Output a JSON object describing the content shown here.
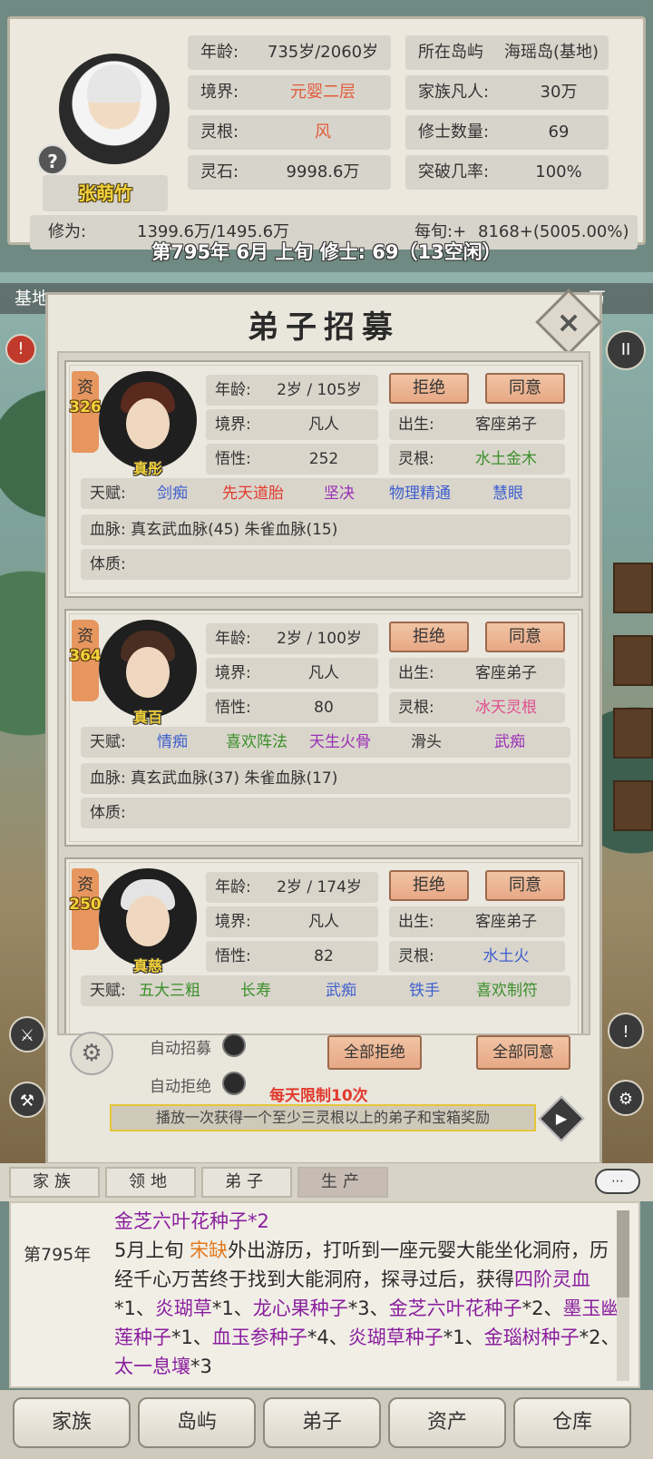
{
  "player": {
    "name": "张萌竹",
    "age_label": "年龄:",
    "age_value": "735岁/2060岁",
    "realm_label": "境界:",
    "realm_value": "元婴二层",
    "root_label": "灵根:",
    "root_value": "风",
    "stones_label": "灵石:",
    "stones_value": "9998.6万",
    "island_label": "所在岛屿",
    "island_value": "海瑶岛(基地)",
    "mortals_label": "家族凡人:",
    "mortals_value": "30万",
    "cultivators_label": "修士数量:",
    "cultivators_value": "69",
    "breakthrough_label": "突破几率:",
    "breakthrough_value": "100%",
    "cultivation_label": "修为:",
    "cultivation_value": "1399.6万/1495.6万",
    "per_turn_label": "每旬:+",
    "per_turn_value": "8168+(5005.00%)"
  },
  "date_line": "第795年 6月 上旬   修士: 69（13空闲）",
  "behind_strip": {
    "left": "基地",
    "right": "万"
  },
  "modal": {
    "title": "弟子招募",
    "close_icon": "close-icon",
    "candidates": [
      {
        "zi_label": "资",
        "zi_value": "326",
        "name": "真彤",
        "age_label": "年龄:",
        "age": "2岁 / 105岁",
        "realm_label": "境界:",
        "realm": "凡人",
        "wit_label": "悟性:",
        "wit": "252",
        "birth_label": "出生:",
        "birth": "客座弟子",
        "root_label": "灵根:",
        "root": "水土金木",
        "reject": "拒绝",
        "accept": "同意",
        "talent_label": "天赋:",
        "talents": [
          "剑痴",
          "先天道胎",
          "坚决",
          "物理精通",
          "慧眼"
        ],
        "bloodline_label": "血脉:",
        "bloodline": "真玄武血脉(45) 朱雀血脉(15)",
        "physique_label": "体质:"
      },
      {
        "zi_label": "资",
        "zi_value": "364",
        "name": "真百",
        "age_label": "年龄:",
        "age": "2岁 / 100岁",
        "realm_label": "境界:",
        "realm": "凡人",
        "wit_label": "悟性:",
        "wit": "80",
        "birth_label": "出生:",
        "birth": "客座弟子",
        "root_label": "灵根:",
        "root": "冰天灵根",
        "reject": "拒绝",
        "accept": "同意",
        "talent_label": "天赋:",
        "talents": [
          "情痴",
          "喜欢阵法",
          "天生火骨",
          "滑头",
          "武痴"
        ],
        "bloodline_label": "血脉:",
        "bloodline": "真玄武血脉(37) 朱雀血脉(17)",
        "physique_label": "体质:"
      },
      {
        "zi_label": "资",
        "zi_value": "250",
        "name": "真慈",
        "age_label": "年龄:",
        "age": "2岁 / 174岁",
        "realm_label": "境界:",
        "realm": "凡人",
        "wit_label": "悟性:",
        "wit": "82",
        "birth_label": "出生:",
        "birth": "客座弟子",
        "root_label": "灵根:",
        "root": "水土火",
        "reject": "拒绝",
        "accept": "同意",
        "talent_label": "天赋:",
        "talents": [
          "五大三粗",
          "长寿",
          "武痴",
          "铁手",
          "喜欢制符"
        ]
      }
    ],
    "auto_recruit": "自动招募",
    "auto_reject": "自动拒绝",
    "reject_all": "全部拒绝",
    "accept_all": "全部同意",
    "daily_limit": "每天限制10次",
    "ad_text": "播放一次获得一个至少三灵根以上的弟子和宝箱奖励"
  },
  "tabs": [
    "家族",
    "领地",
    "弟子",
    "生产"
  ],
  "log": {
    "year": "第795年",
    "line1": "金芝六叶花种子*2",
    "month": "5月上旬",
    "actor": "宋缺",
    "body1": "外出游历，打听到一座元婴大能坐化洞府，历经千心万苦终于找到大能洞府，探寻过后，获得",
    "items": [
      {
        "name": "四阶灵血",
        "qty": "*1、"
      },
      {
        "name": "炎瑚草",
        "qty": "*1、"
      },
      {
        "name": "龙心果种子",
        "qty": "*3、"
      },
      {
        "name": "金芝六叶花种子",
        "qty": "*2、"
      },
      {
        "name": "墨玉幽莲种子",
        "qty": "*1、"
      },
      {
        "name": "血玉参种子",
        "qty": "*4、"
      },
      {
        "name": "炎瑚草种子",
        "qty": "*1、"
      },
      {
        "name": "金瑙树种子",
        "qty": "*2、"
      },
      {
        "name": "太一息壤",
        "qty": "*3"
      }
    ]
  },
  "bottom_nav": [
    "家族",
    "岛屿",
    "弟子",
    "资产",
    "仓库"
  ],
  "colors": {
    "accent_red": "#e25b3b",
    "button": "#e7a886",
    "talent_blue": "#3f5fcf",
    "log_purple": "#8a1f9e",
    "log_orange": "#e07a1f"
  }
}
